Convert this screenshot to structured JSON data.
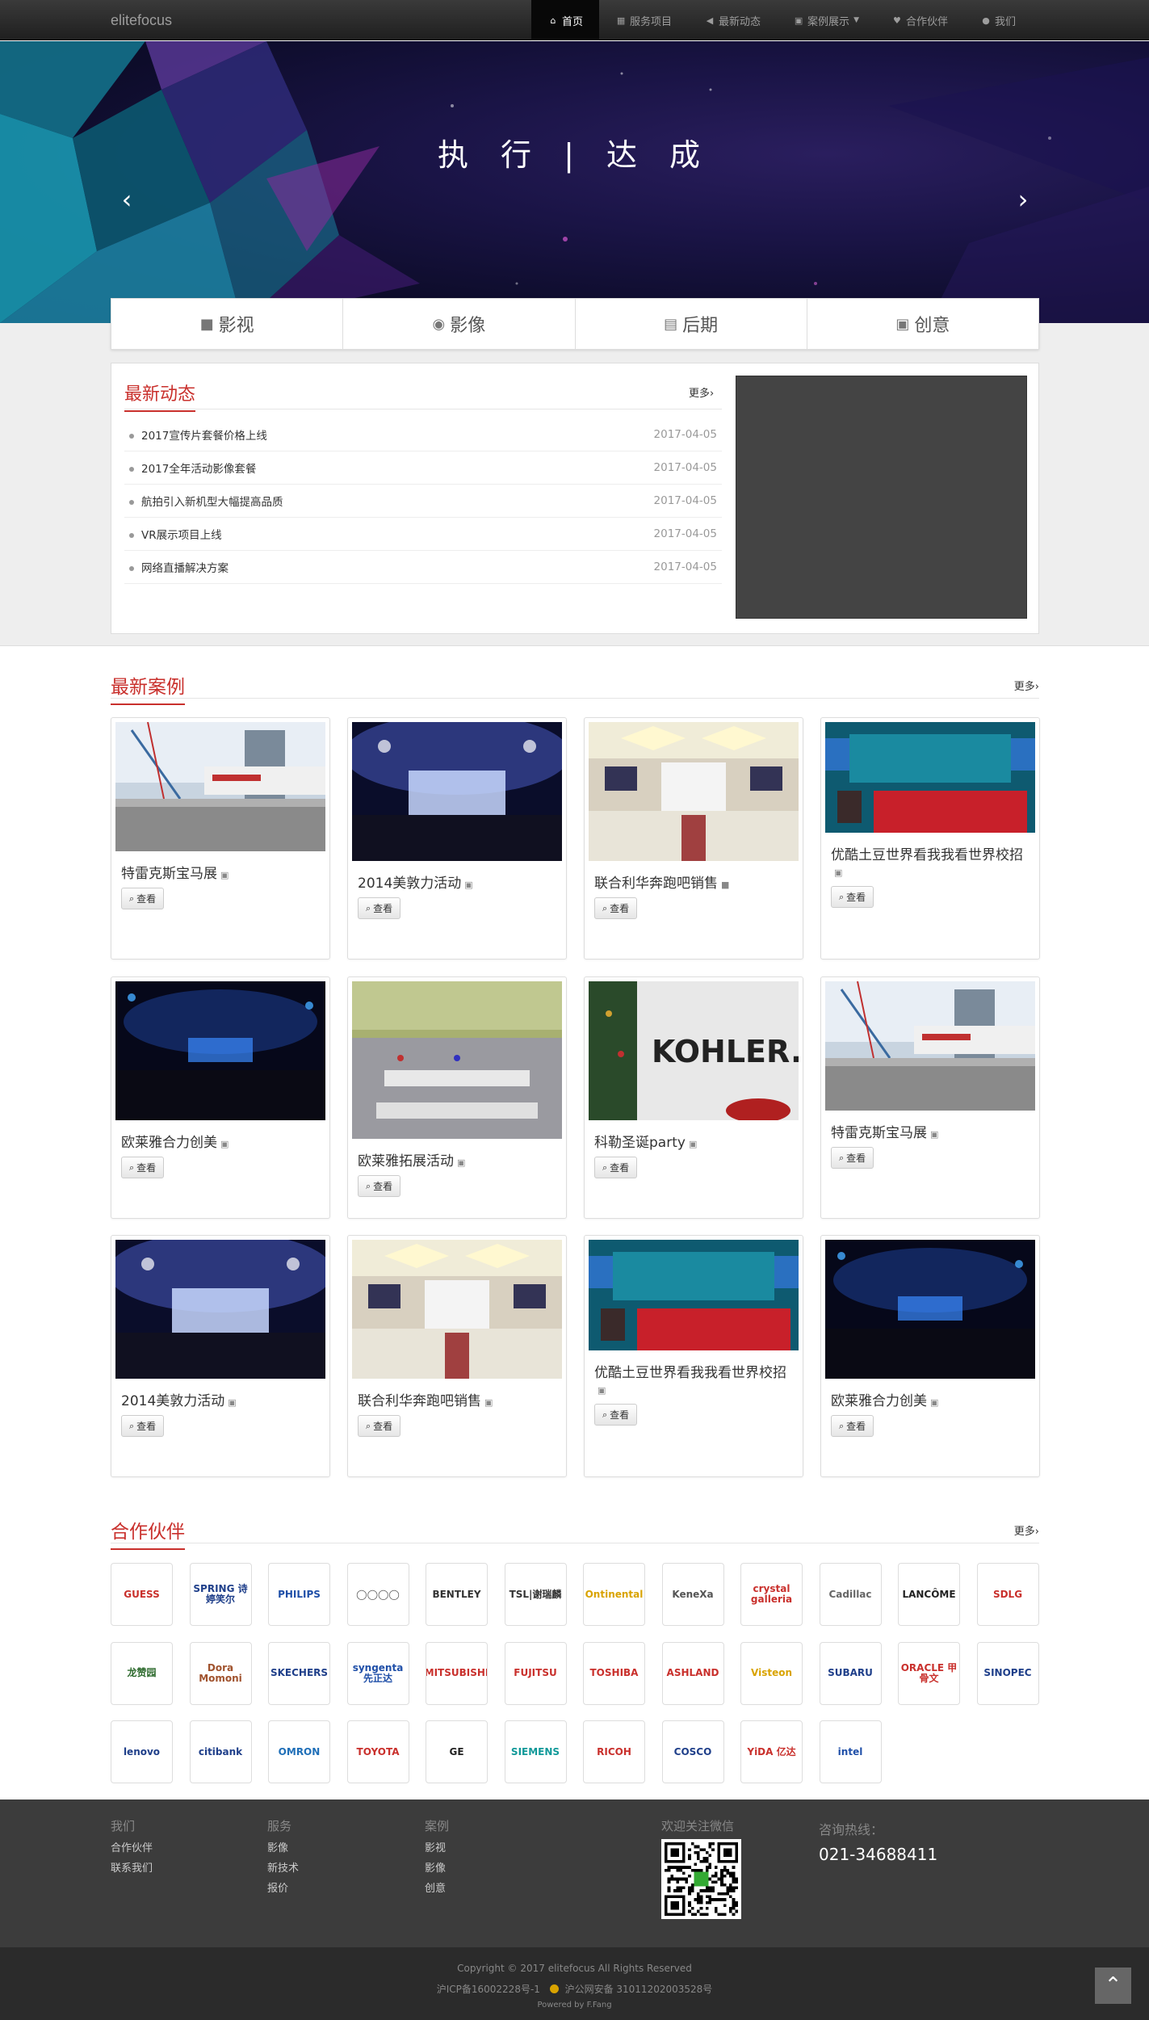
{
  "navbar": {
    "brand": "elitefocus",
    "items": [
      {
        "label": "首页",
        "icon": "home-icon",
        "glyph": "⌂",
        "active": true
      },
      {
        "label": "服务项目",
        "icon": "th-large-icon",
        "glyph": "▦"
      },
      {
        "label": "最新动态",
        "icon": "bullhorn-icon",
        "glyph": "◀"
      },
      {
        "label": "案例展示",
        "icon": "picture-icon",
        "glyph": "▣",
        "dropdown": true
      },
      {
        "label": "合作伙伴",
        "icon": "heart-icon",
        "glyph": "♥"
      },
      {
        "label": "我们",
        "icon": "user-icon",
        "glyph": "●"
      }
    ]
  },
  "banner": {
    "title": "执 行 | 达 成",
    "prev": "‹",
    "next": "›",
    "active_slide": 3,
    "slide_count": 3
  },
  "service_tabs": [
    {
      "label": "影视",
      "icon": "video-camera-icon",
      "glyph": "■"
    },
    {
      "label": "影像",
      "icon": "camera-icon",
      "glyph": "◉"
    },
    {
      "label": "后期",
      "icon": "film-icon",
      "glyph": "▤"
    },
    {
      "label": "创意",
      "icon": "picture-icon",
      "glyph": "▣"
    }
  ],
  "news": {
    "heading": "最新动态",
    "more": "更多›",
    "items": [
      {
        "title": "2017宣传片套餐价格上线",
        "date": "2017-04-05"
      },
      {
        "title": "2017全年活动影像套餐",
        "date": "2017-04-05"
      },
      {
        "title": "航拍引入新机型大幅提高品质",
        "date": "2017-04-05"
      },
      {
        "title": "VR展示项目上线",
        "date": "2017-04-05"
      },
      {
        "title": "网络直播解决方案",
        "date": "2017-04-05"
      }
    ]
  },
  "cases": {
    "heading": "最新案例",
    "more": "更多›",
    "view_label": "查看",
    "items": [
      {
        "title": "特雷克斯宝马展",
        "icon": "picture-icon",
        "glyph": "▣",
        "theme": "expo"
      },
      {
        "title": "2014美敦力活动",
        "icon": "picture-icon",
        "glyph": "▣",
        "theme": "stage-blue"
      },
      {
        "title": "联合利华奔跑吧销售",
        "icon": "video-camera-icon",
        "glyph": "■",
        "theme": "ballroom"
      },
      {
        "title": "优酷土豆世界看我我看世界校招",
        "icon": "picture-icon",
        "glyph": "▣",
        "theme": "stage-red"
      },
      {
        "title": "欧莱雅合力创美",
        "icon": "picture-icon",
        "glyph": "▣",
        "theme": "hall-dark"
      },
      {
        "title": "欧莱雅拓展活动",
        "icon": "picture-icon",
        "glyph": "▣",
        "theme": "gym"
      },
      {
        "title": "科勒圣诞party",
        "icon": "picture-icon",
        "glyph": "▣",
        "theme": "kohler"
      },
      {
        "title": "特雷克斯宝马展",
        "icon": "picture-icon",
        "glyph": "▣",
        "theme": "expo"
      },
      {
        "title": "2014美敦力活动",
        "icon": "picture-icon",
        "glyph": "▣",
        "theme": "stage-blue"
      },
      {
        "title": "联合利华奔跑吧销售",
        "icon": "picture-icon",
        "glyph": "▣",
        "theme": "ballroom"
      },
      {
        "title": "优酷土豆世界看我我看世界校招",
        "icon": "picture-icon",
        "glyph": "▣",
        "theme": "stage-red"
      },
      {
        "title": "欧莱雅合力创美",
        "icon": "picture-icon",
        "glyph": "▣",
        "theme": "hall-dark"
      }
    ],
    "kohler_text": "KOHLER."
  },
  "partners": {
    "heading": "合作伙伴",
    "more": "更多›",
    "logos": [
      {
        "text": "GUESS",
        "color": "#c9302c"
      },
      {
        "text": "SPRING 诗婷笑尔",
        "color": "#1f3f8a"
      },
      {
        "text": "PHILIPS",
        "color": "#1f4fa8"
      },
      {
        "text": "◯◯◯◯",
        "color": "#555"
      },
      {
        "text": "BENTLEY",
        "color": "#333"
      },
      {
        "text": "TSL|谢瑞麟",
        "color": "#333"
      },
      {
        "text": "Ontinental",
        "color": "#d9a300"
      },
      {
        "text": "KeneXa",
        "color": "#555"
      },
      {
        "text": "crystal galleria",
        "color": "#c9302c"
      },
      {
        "text": "Cadillac",
        "color": "#666"
      },
      {
        "text": "LANCÔME",
        "color": "#222"
      },
      {
        "text": "SDLG",
        "color": "#c9302c"
      },
      {
        "text": "龙赞园",
        "color": "#2d6a2d"
      },
      {
        "text": "Dora Momoni",
        "color": "#a0522d"
      },
      {
        "text": "SKECHERS",
        "color": "#1f3f8a"
      },
      {
        "text": "syngenta 先正达",
        "color": "#1f4fa8"
      },
      {
        "text": "MITSUBISHI",
        "color": "#c9302c"
      },
      {
        "text": "FUJITSU",
        "color": "#c9302c"
      },
      {
        "text": "TOSHIBA",
        "color": "#c9302c"
      },
      {
        "text": "ASHLAND",
        "color": "#c9302c"
      },
      {
        "text": "Visteon",
        "color": "#d9a300"
      },
      {
        "text": "SUBARU",
        "color": "#1f3f8a"
      },
      {
        "text": "ORACLE 甲骨文",
        "color": "#c9302c"
      },
      {
        "text": "SINOPEC",
        "color": "#1f3f8a"
      },
      {
        "text": "lenovo",
        "color": "#1f3f8a"
      },
      {
        "text": "citibank",
        "color": "#1f3f8a"
      },
      {
        "text": "OMRON",
        "color": "#1f6fb8"
      },
      {
        "text": "TOYOTA",
        "color": "#c9302c"
      },
      {
        "text": "GE",
        "color": "#222"
      },
      {
        "text": "SIEMENS",
        "color": "#119999"
      },
      {
        "text": "RICOH",
        "color": "#c9302c"
      },
      {
        "text": "COSCO",
        "color": "#1f3f8a"
      },
      {
        "text": "YiDA 亿达",
        "color": "#c9302c"
      },
      {
        "text": "intel",
        "color": "#1f4fa8"
      }
    ]
  },
  "footer": {
    "cols": [
      {
        "title": "我们",
        "links": [
          "合作伙伴",
          "联系我们"
        ]
      },
      {
        "title": "服务",
        "links": [
          "影像",
          "新技术",
          "报价"
        ]
      },
      {
        "title": "案例",
        "links": [
          "影视",
          "影像",
          "创意"
        ]
      }
    ],
    "wechat_label": "欢迎关注微信",
    "hotline_label": "咨询热线：",
    "hotline_number": "021-34688411",
    "copyright": "Copyright © 2017 elitefocus All Rights Reserved",
    "icp": "沪ICP备16002228号-1",
    "police": "沪公网安备 31011202003528号",
    "powered": "Powered by F.Fang",
    "to_top": "⌃"
  }
}
